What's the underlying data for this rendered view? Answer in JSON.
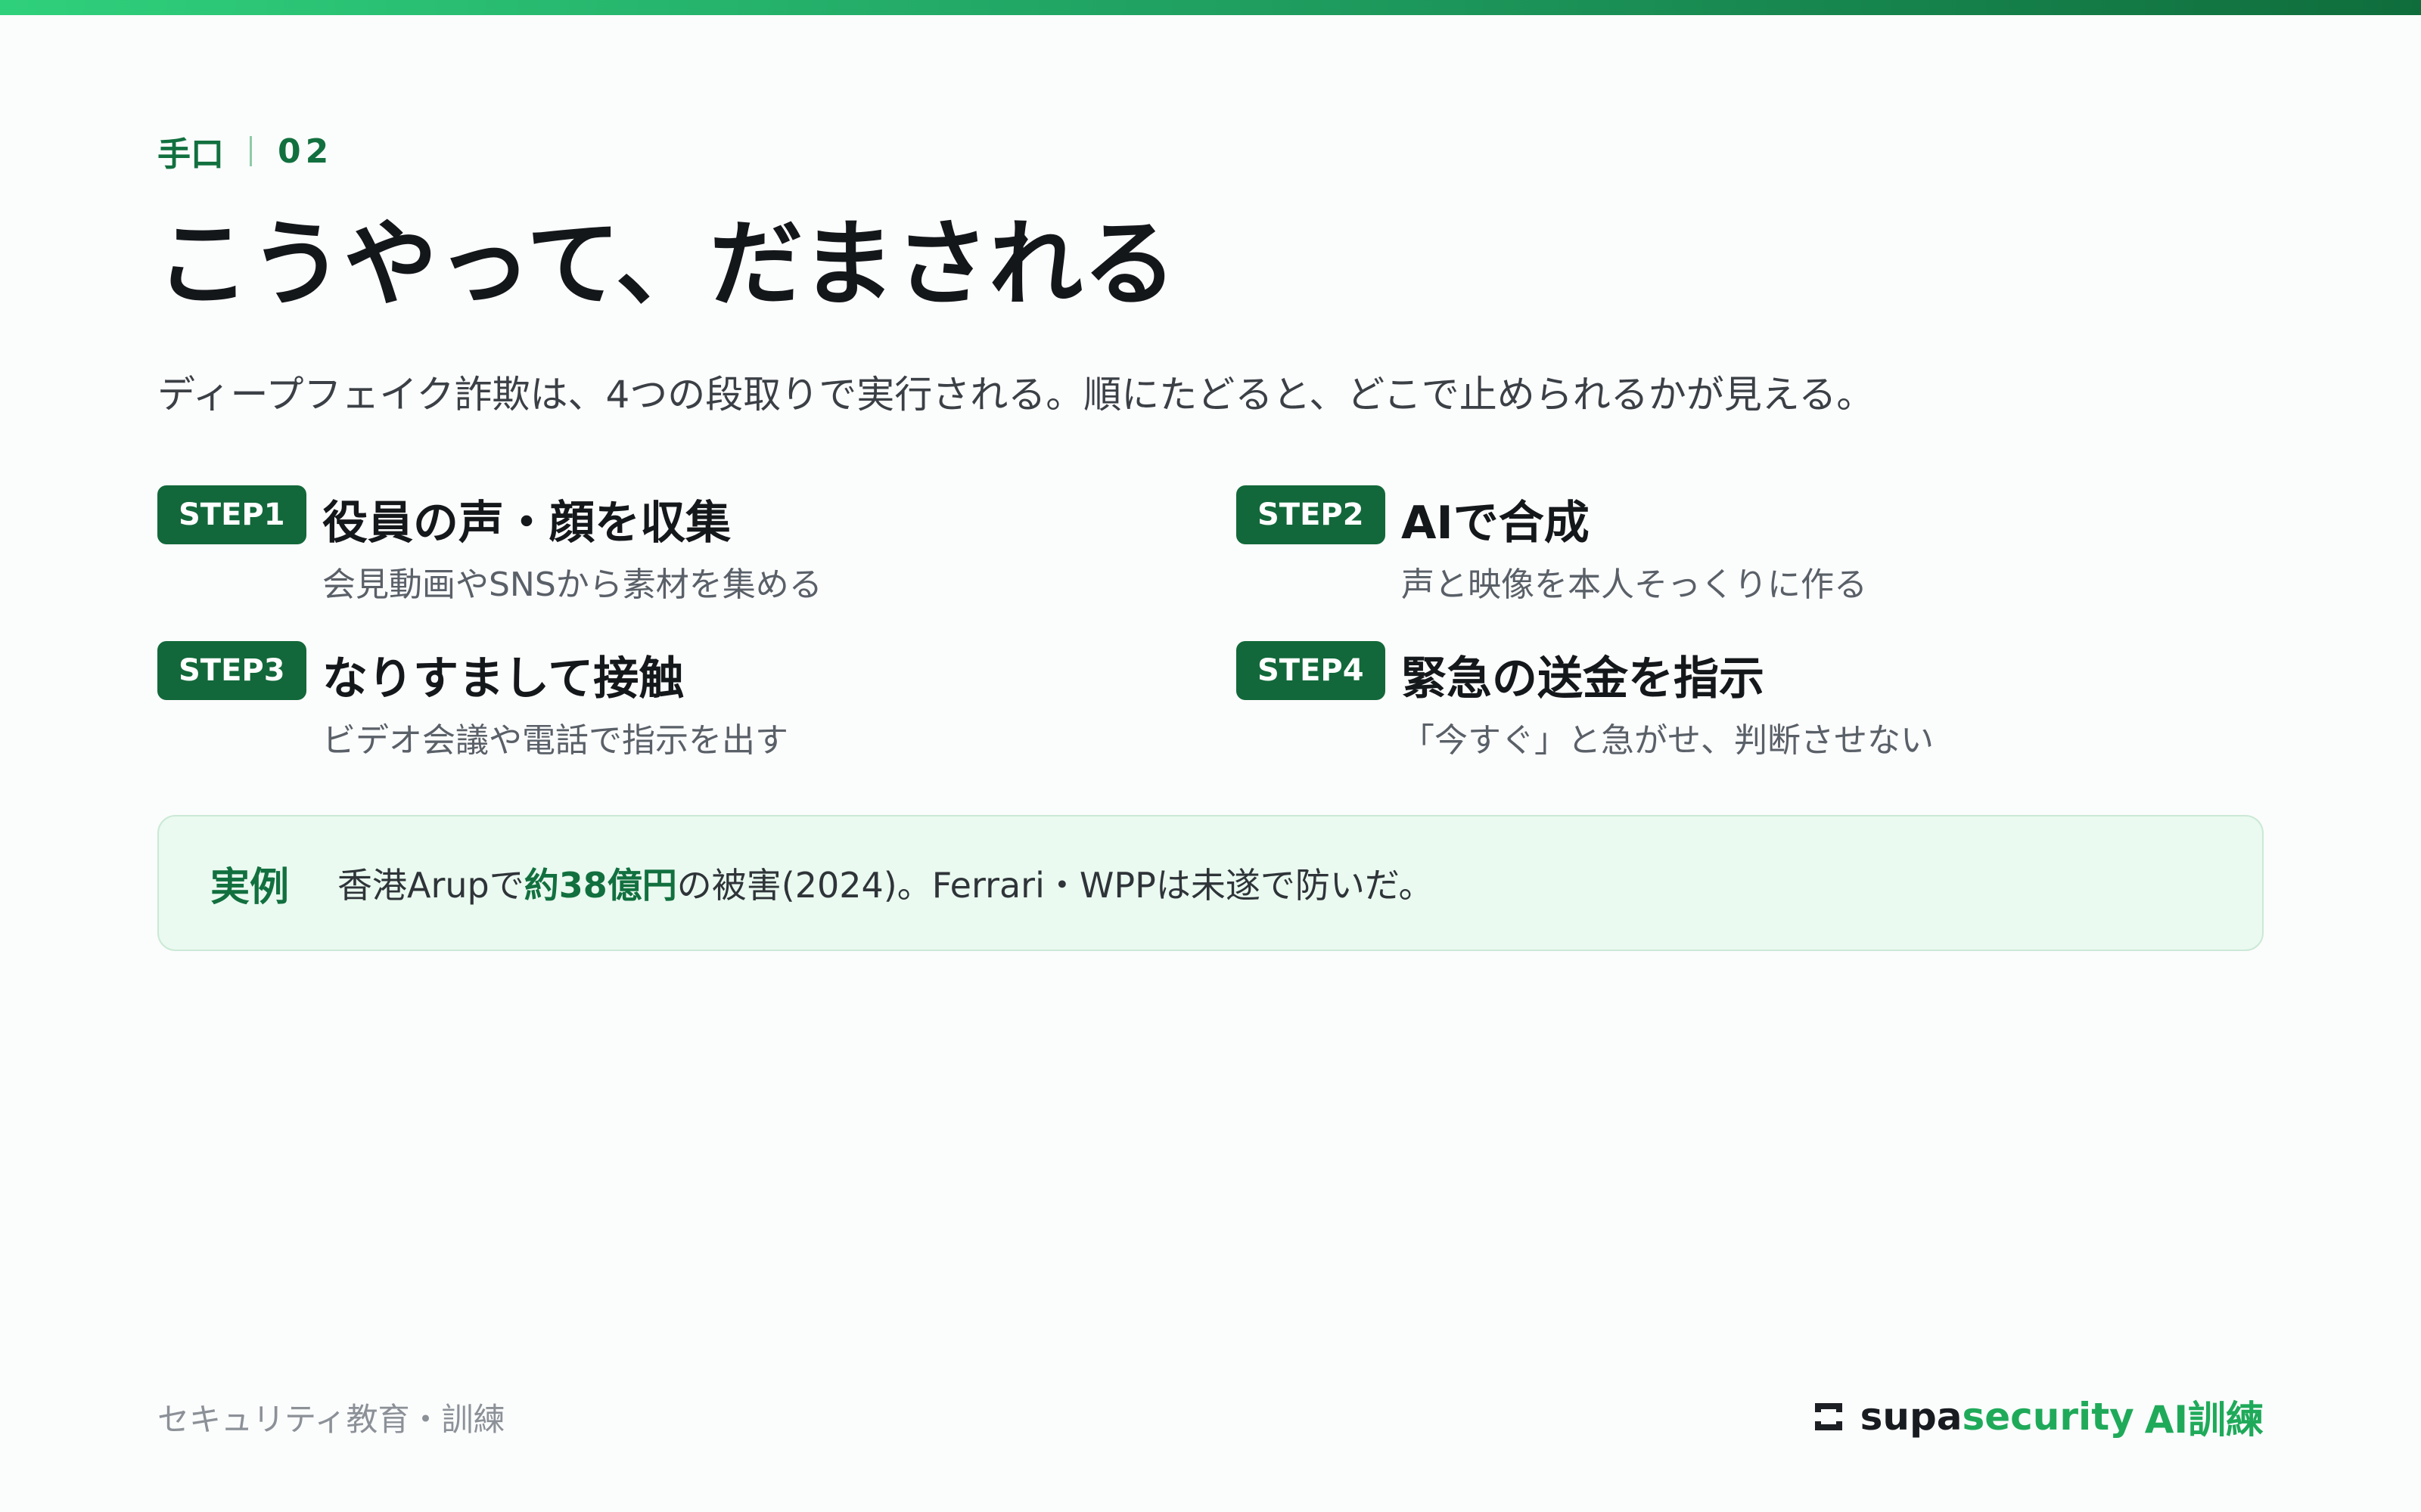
{
  "kicker": {
    "label": "手口",
    "number": "02"
  },
  "title": "こうやって、だまされる",
  "subtitle": "ディープフェイク詐欺は、4つの段取りで実行される。順にたどると、どこで止められるかが見える。",
  "steps": [
    {
      "badge": "STEP1",
      "title": "役員の声・顔を収集",
      "description": "会見動画やSNSから素材を集める"
    },
    {
      "badge": "STEP2",
      "title": "AIで合成",
      "description": "声と映像を本人そっくりに作る"
    },
    {
      "badge": "STEP3",
      "title": "なりすまして接触",
      "description": "ビデオ会議や電話で指示を出す"
    },
    {
      "badge": "STEP4",
      "title": "緊急の送金を指示",
      "description": "「今すぐ」と急がせ、判断させない"
    }
  ],
  "example": {
    "label": "実例",
    "text_before": "香港Arupで",
    "highlight": "約38億円",
    "text_after": "の被害(2024)。Ferrari・WPPは未遂で防いだ。"
  },
  "footer": {
    "left_text": "セキュリティ教育・訓練",
    "brand_supa": "supa",
    "brand_security": "security",
    "brand_suffix": "AI訓練"
  },
  "colors": {
    "accent_green": "#12703f",
    "badge_green": "#12683a",
    "example_background": "#eafaf0",
    "brand_green": "#1faa5a"
  },
  "icons": {
    "brand": "logo-bracket-icon"
  }
}
